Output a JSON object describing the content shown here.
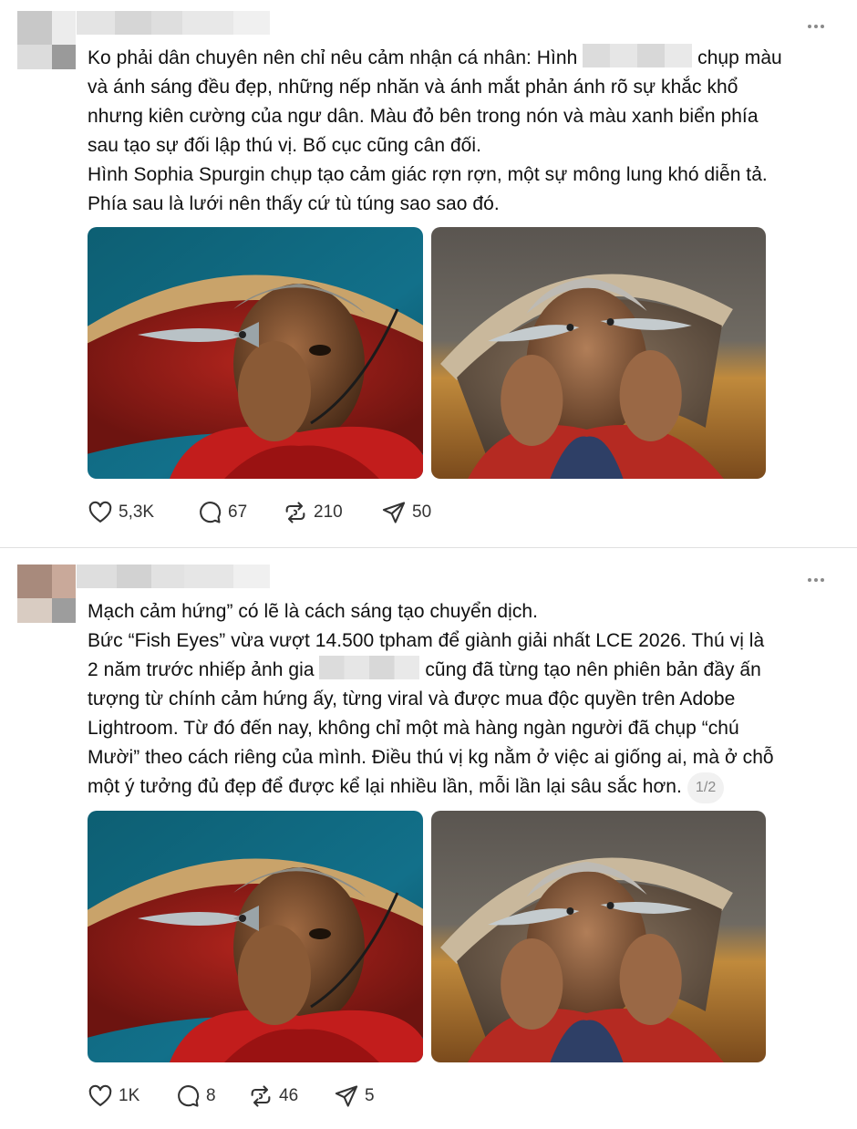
{
  "colors": {
    "text": "#101010",
    "muted": "#8a8a8a",
    "divider": "#e0e0e0"
  },
  "posts": [
    {
      "lines": [
        [
          "Ko phải dân chuyên nên chỉ nêu cảm nhận cá nhân: Hình ",
          " chụp màu"
        ],
        [
          "và ánh sáng đều đẹp, những nếp nhăn và ánh mắt phản ánh rõ sự khắc khổ"
        ],
        [
          "nhưng kiên cường của ngư dân. Màu đỏ bên trong nón và màu xanh biển phía"
        ],
        [
          "sau tạo sự đối lập thú vị. Bố cục cũng cân đối."
        ],
        [
          "Hình Sophia Spurgin chụp tạo cảm giác rợn rợn, một sự mông lung khó diễn tả."
        ],
        [
          "Phía sau là lưới nên thấy cứ tù túng sao sao đó."
        ]
      ],
      "likes": "5,3K",
      "replies": "67",
      "reposts": "210",
      "shares": "50",
      "icons": [
        "heart-icon",
        "comment-icon",
        "repost-icon",
        "share-icon"
      ]
    },
    {
      "lines": [
        [
          "Mạch cảm hứng” có lẽ là cách sáng tạo chuyển dịch."
        ],
        [
          "Bức “Fish Eyes” vừa vượt 14.500 tpham để giành giải nhất LCE 2026. Thú vị là"
        ],
        [
          "2 năm trước nhiếp ảnh gia ",
          " cũng đã từng tạo nên phiên bản đầy ấn"
        ],
        [
          "tượng từ chính cảm hứng ấy, từng viral và được mua độc quyền trên Adobe"
        ],
        [
          "Lightroom. Từ đó đến nay, không chỉ một mà hàng ngàn người đã chụp “chú"
        ],
        [
          "Mười” theo cách riêng của mình. Điều thú vị kg nằm ở việc ai giống ai, mà ở chỗ"
        ],
        [
          "một ý tưởng đủ đẹp để được kể lại nhiều lần, mỗi lần lại sâu sắc hơn."
        ]
      ],
      "pager": "1/2",
      "likes": "1K",
      "replies": "8",
      "reposts": "46",
      "shares": "5",
      "icons": [
        "heart-icon",
        "comment-icon",
        "repost-icon",
        "share-icon"
      ]
    }
  ]
}
